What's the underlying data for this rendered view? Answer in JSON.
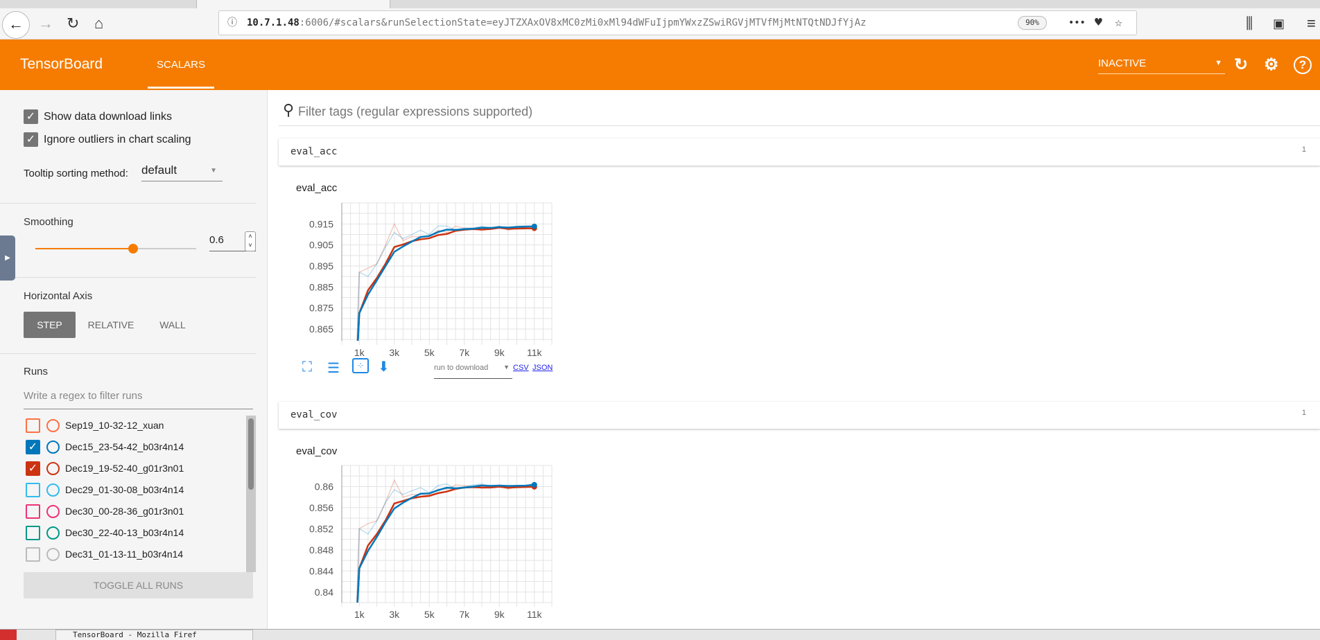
{
  "browser": {
    "url_host": "10.7.1.48",
    "url_rest": ":6006/#scalars&runSelectionState=eyJTZXAxOV8xMC0zMi0xMl94dWFuIjpmYWxzZSwiRGVjMTVfMjMtNTQtNDJfYjAz",
    "zoom": "90%"
  },
  "header": {
    "brand": "TensorBoard",
    "tab": "SCALARS",
    "reload_state": "INACTIVE"
  },
  "sidebar": {
    "show_download_links": {
      "label": "Show data download links",
      "checked": true
    },
    "ignore_outliers": {
      "label": "Ignore outliers in chart scaling",
      "checked": true
    },
    "tooltip_label": "Tooltip sorting method:",
    "tooltip_value": "default",
    "smoothing_label": "Smoothing",
    "smoothing_value": "0.6",
    "smoothing": 0.6,
    "axis_label": "Horizontal Axis",
    "axis_options": [
      "STEP",
      "RELATIVE",
      "WALL"
    ],
    "axis_selected": "STEP",
    "runs_label": "Runs",
    "runs_filter_placeholder": "Write a regex to filter runs",
    "runs": [
      {
        "name": "Sep19_10-32-12_xuan",
        "checked": false,
        "color": "#ff7043"
      },
      {
        "name": "Dec15_23-54-42_b03r4n14",
        "checked": true,
        "color": "#0077bb"
      },
      {
        "name": "Dec19_19-52-40_g01r3n01",
        "checked": true,
        "color": "#cc3311"
      },
      {
        "name": "Dec29_01-30-08_b03r4n14",
        "checked": false,
        "color": "#33bbee"
      },
      {
        "name": "Dec30_00-28-36_g01r3n01",
        "checked": false,
        "color": "#ee3377"
      },
      {
        "name": "Dec30_22-40-13_b03r4n14",
        "checked": false,
        "color": "#009988"
      },
      {
        "name": "Dec31_01-13-11_b03r4n14",
        "checked": false,
        "color": "#bbbbbb"
      }
    ],
    "toggle_all": "TOGGLE ALL RUNS"
  },
  "filter": {
    "placeholder": "Filter tags (regular expressions supported)"
  },
  "groups": [
    {
      "name": "eval_acc",
      "count": "1"
    },
    {
      "name": "eval_cov",
      "count": "1"
    }
  ],
  "chart_toolbar": {
    "run_to_download": "run to download",
    "csv": "CSV",
    "json": "JSON"
  },
  "chart_data": [
    {
      "type": "line",
      "title": "eval_acc",
      "xlim": [
        0,
        12000
      ],
      "ylim": [
        0.8594,
        0.925
      ],
      "yticks": [
        0.865,
        0.875,
        0.885,
        0.895,
        0.905,
        0.915
      ],
      "ytick_labels": [
        "0.865",
        "0.875",
        "0.885",
        "0.895",
        "0.905",
        "0.915"
      ],
      "xticks": [
        1000,
        3000,
        5000,
        7000,
        9000,
        11000
      ],
      "xtick_labels": [
        "1k",
        "3k",
        "5k",
        "7k",
        "9k",
        "11k"
      ],
      "grid": true,
      "smoothing": 0.6,
      "x": [
        800,
        1000,
        1500,
        2000,
        2500,
        3000,
        3500,
        4000,
        4500,
        5000,
        5500,
        6000,
        6500,
        7000,
        7500,
        8000,
        8500,
        9000,
        9500,
        10000,
        10500,
        11000
      ],
      "series": [
        {
          "run": "Dec19_19-52-40_g01r3n01",
          "color": "#cc3311",
          "values": [
            0.84,
            0.892,
            0.894,
            0.896,
            0.905,
            0.915,
            0.907,
            0.909,
            0.909,
            0.909,
            0.912,
            0.911,
            0.914,
            0.913,
            0.913,
            0.912,
            0.913,
            0.914,
            0.912,
            0.913,
            0.913,
            0.913
          ]
        },
        {
          "run": "Dec15_23-54-42_b03r4n14",
          "color": "#0077bb",
          "values": [
            0.84,
            0.892,
            0.89,
            0.896,
            0.904,
            0.911,
            0.908,
            0.91,
            0.912,
            0.91,
            0.914,
            0.914,
            0.912,
            0.913,
            0.913,
            0.914,
            0.913,
            0.914,
            0.913,
            0.914,
            0.914,
            0.914
          ]
        }
      ]
    },
    {
      "type": "line",
      "title": "eval_cov",
      "xlim": [
        0,
        12000
      ],
      "ylim": [
        0.838,
        0.864
      ],
      "yticks": [
        0.84,
        0.844,
        0.848,
        0.852,
        0.856,
        0.86
      ],
      "ytick_labels": [
        "0.84",
        "0.844",
        "0.848",
        "0.852",
        "0.856",
        "0.86"
      ],
      "xticks": [
        1000,
        3000,
        5000,
        7000,
        9000,
        11000
      ],
      "xtick_labels": [
        "1k",
        "3k",
        "5k",
        "7k",
        "9k",
        "11k"
      ],
      "grid": true,
      "smoothing": 0.6,
      "x": [
        800,
        1000,
        1500,
        2000,
        2500,
        3000,
        3500,
        4000,
        4500,
        5000,
        5500,
        6000,
        6500,
        7000,
        7500,
        8000,
        8500,
        9000,
        9500,
        10000,
        10500,
        11000
      ],
      "series": [
        {
          "run": "Dec19_19-52-40_g01r3n01",
          "color": "#cc3311",
          "values": [
            0.832,
            0.852,
            0.853,
            0.8535,
            0.857,
            0.8612,
            0.858,
            0.8585,
            0.8585,
            0.8585,
            0.8595,
            0.8595,
            0.8603,
            0.8602,
            0.86,
            0.8597,
            0.8598,
            0.8602,
            0.8595,
            0.86,
            0.86,
            0.86
          ]
        },
        {
          "run": "Dec15_23-54-42_b03r4n14",
          "color": "#0077bb",
          "values": [
            0.832,
            0.852,
            0.851,
            0.8535,
            0.857,
            0.8594,
            0.8585,
            0.8592,
            0.8598,
            0.8588,
            0.8602,
            0.8605,
            0.8595,
            0.86,
            0.8603,
            0.8605,
            0.86,
            0.8603,
            0.86,
            0.8602,
            0.8602,
            0.8606
          ]
        }
      ]
    }
  ],
  "taskbar": {
    "items": [
      "TensorBoard - Mozilla Firef"
    ]
  },
  "colors": {
    "header": "#f57c00",
    "link": "#1e88e5"
  }
}
